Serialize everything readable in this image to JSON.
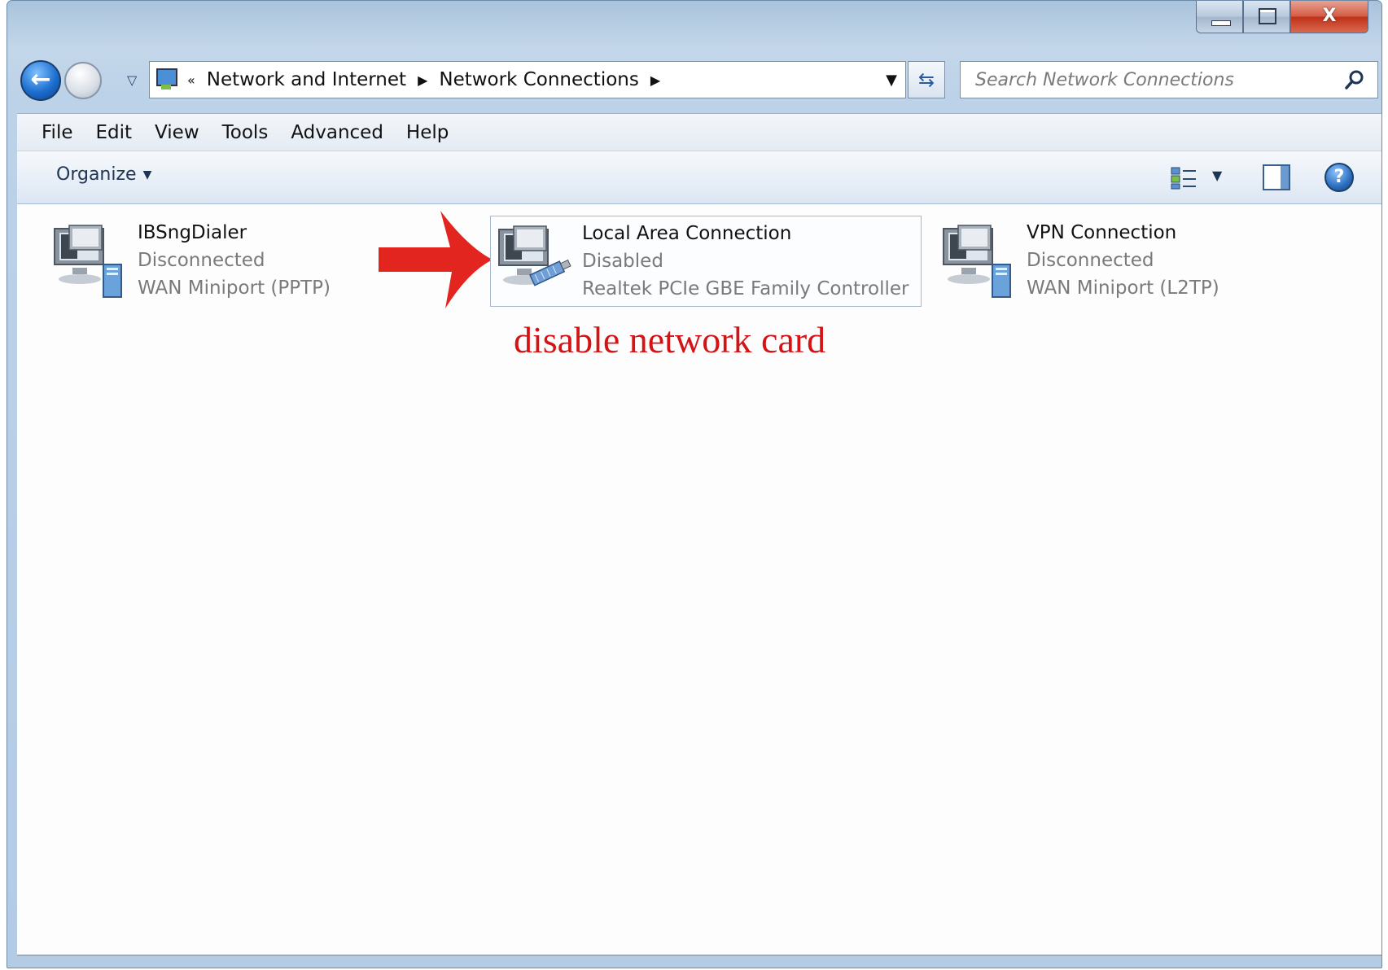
{
  "window": {
    "minimize_glyph": "",
    "close_glyph": "X"
  },
  "nav": {
    "overflow_glyph": "«",
    "breadcrumbs": [
      "Network and Internet",
      "Network Connections"
    ],
    "search_placeholder": "Search Network Connections"
  },
  "menu": [
    "File",
    "Edit",
    "View",
    "Tools",
    "Advanced",
    "Help"
  ],
  "toolbar": {
    "organize_label": "Organize",
    "help_glyph": "?"
  },
  "connections": [
    {
      "name": "IBSngDialer",
      "status": "Disconnected",
      "device": "WAN Miniport (PPTP)",
      "icon": "vpn-dialup-icon"
    },
    {
      "name": "Local Area Connection",
      "status": "Disabled",
      "device": "Realtek PCIe GBE Family Controller",
      "icon": "lan-adapter-icon",
      "selected": true
    },
    {
      "name": "VPN Connection",
      "status": "Disconnected",
      "device": "WAN Miniport (L2TP)",
      "icon": "vpn-dialup-icon"
    }
  ],
  "annotation": {
    "text": "disable network card",
    "color": "#d41414"
  },
  "colors": {
    "frame": "#b3cbe3",
    "accent": "#1e6fd0",
    "status_text": "#7a7a7a"
  }
}
